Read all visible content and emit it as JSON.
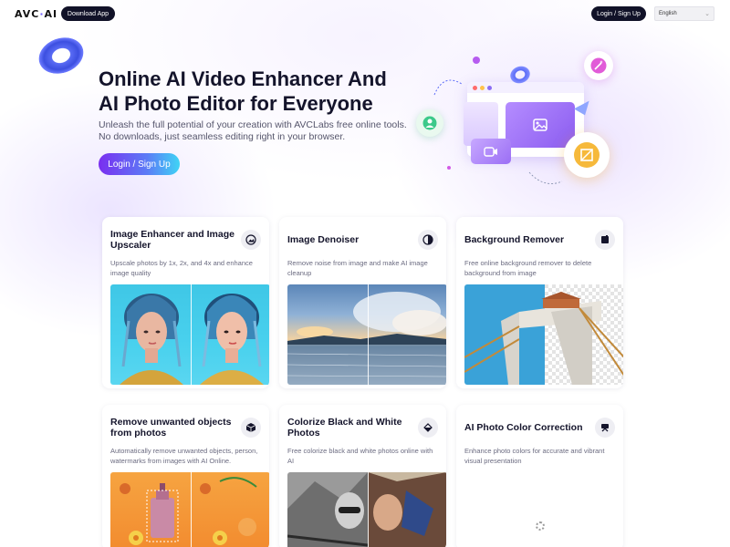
{
  "header": {
    "logo_text": "AVC",
    "logo_dot": "·",
    "logo_suffix": "AI",
    "download_label": "Download App",
    "login_label": "Login / Sign Up",
    "language": "English"
  },
  "hero": {
    "title_line1": "Online AI Video Enhancer And",
    "title_line2": "AI Photo Editor for Everyone",
    "subtitle_line1": "Unleash the full potential of your creation with AVCLabs free online tools.",
    "subtitle_line2": "No downloads, just seamless editing right in your browser.",
    "cta_label": "Login / Sign Up"
  },
  "cards": [
    {
      "title_line1": "Image Enhancer and Image",
      "title_line2": "Upscaler",
      "desc_line1": "Upscale photos by 1x, 2x, and 4x and enhance",
      "desc_line2": "image quality",
      "icon": "image-enhance-icon"
    },
    {
      "title_line1": "Image Denoiser",
      "title_line2": "",
      "desc_line1": "Remove noise from image and make AI image",
      "desc_line2": "cleanup",
      "icon": "denoise-icon"
    },
    {
      "title_line1": "Background Remover",
      "title_line2": "",
      "desc_line1": "Free online background remover to delete",
      "desc_line2": "background from image",
      "icon": "background-remove-icon"
    },
    {
      "title_line1": "Remove unwanted objects",
      "title_line2": "from photos",
      "desc_line1": "Automatically remove unwanted objects, person,",
      "desc_line2": "watermarks from images with AI Online.",
      "icon": "object-remove-icon"
    },
    {
      "title_line1": "Colorize Black and White",
      "title_line2": "Photos",
      "desc_line1": "Free colorize black and white photos online with AI",
      "desc_line2": "",
      "icon": "colorize-icon"
    },
    {
      "title_line1": "AI Photo Color Correction",
      "title_line2": "",
      "desc_line1": "Enhance photo colors for accurate and vibrant",
      "desc_line2": "visual presentation",
      "icon": "color-correction-icon"
    }
  ],
  "colors": {
    "accent_dark": "#111228",
    "brand_purple": "#7a2ff0",
    "brand_cyan": "#3fd4f5"
  }
}
